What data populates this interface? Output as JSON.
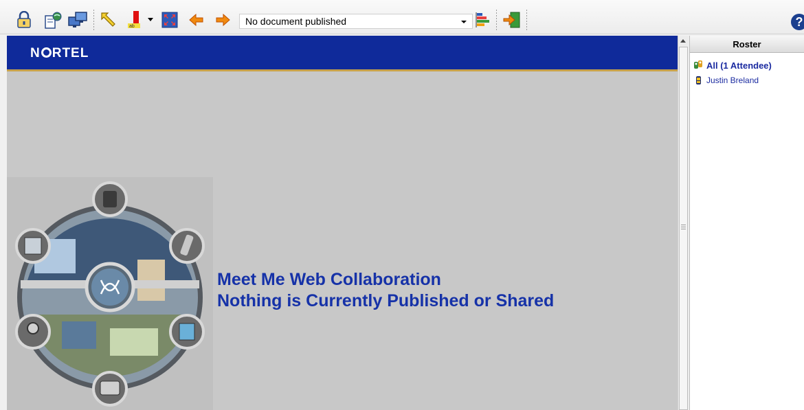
{
  "toolbar": {
    "buttons": [
      {
        "name": "lock-icon"
      },
      {
        "name": "share-document-icon"
      },
      {
        "name": "share-desktop-icon"
      },
      {
        "name": "pointer-tool-icon"
      },
      {
        "name": "highlight-tool-icon"
      },
      {
        "name": "fit-to-window-icon"
      },
      {
        "name": "previous-page-icon"
      },
      {
        "name": "next-page-icon"
      }
    ],
    "document_select": {
      "value": "No document published"
    },
    "extra_buttons": [
      {
        "name": "bar-chart-icon"
      },
      {
        "name": "exit-icon"
      }
    ],
    "help": {
      "label": "?"
    }
  },
  "banner": {
    "logo_text_pre": "N",
    "logo_text_post": "RTEL"
  },
  "main": {
    "title_line1": "Meet Me Web Collaboration",
    "title_line2": "Nothing is Currently Published or Shared"
  },
  "roster": {
    "header": "Roster",
    "all_label": "All (1  Attendee)",
    "attendees": [
      "Justin Breland"
    ]
  },
  "colors": {
    "banner": "#0f2a9a",
    "text_accent": "#1632a8",
    "roster_text": "#1a2aa0"
  }
}
